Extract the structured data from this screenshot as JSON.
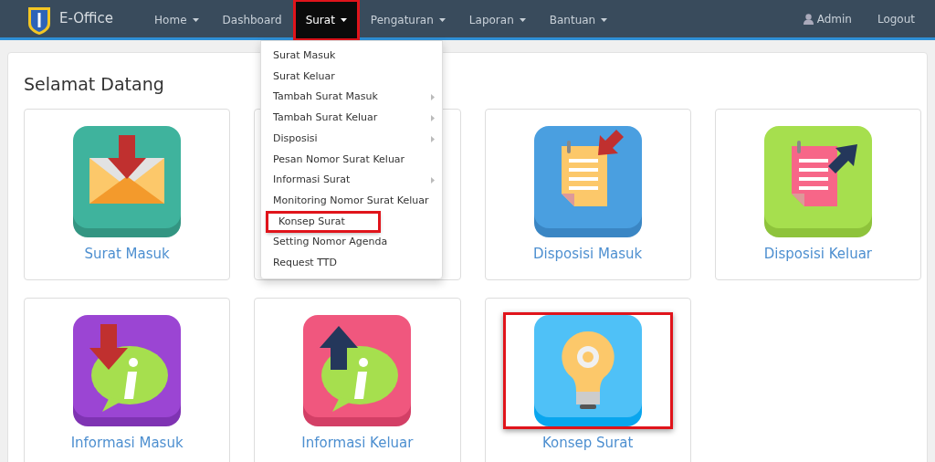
{
  "navbar": {
    "brand": "E-Office",
    "items": [
      {
        "label": "Home",
        "caret": true,
        "selected": false,
        "highlighted": false
      },
      {
        "label": "Dashboard",
        "caret": false,
        "selected": false,
        "highlighted": false
      },
      {
        "label": "Surat",
        "caret": true,
        "selected": true,
        "highlighted": true
      },
      {
        "label": "Pengaturan",
        "caret": true,
        "selected": false,
        "highlighted": false
      },
      {
        "label": "Laporan",
        "caret": true,
        "selected": false,
        "highlighted": false
      },
      {
        "label": "Bantuan",
        "caret": true,
        "selected": false,
        "highlighted": false
      }
    ],
    "user": "Admin",
    "logout": "Logout"
  },
  "dropdown": [
    {
      "label": "Surat Masuk",
      "submenu": false,
      "highlighted": false
    },
    {
      "label": "Surat Keluar",
      "submenu": false,
      "highlighted": false
    },
    {
      "label": "Tambah Surat Masuk",
      "submenu": true,
      "highlighted": false
    },
    {
      "label": "Tambah Surat Keluar",
      "submenu": true,
      "highlighted": false
    },
    {
      "label": "Disposisi",
      "submenu": true,
      "highlighted": false
    },
    {
      "label": "Pesan Nomor Surat Keluar",
      "submenu": false,
      "highlighted": false
    },
    {
      "label": "Informasi Surat",
      "submenu": true,
      "highlighted": false
    },
    {
      "label": "Monitoring Nomor Surat Keluar",
      "submenu": false,
      "highlighted": false
    },
    {
      "label": "Konsep Surat",
      "submenu": false,
      "highlighted": true
    },
    {
      "label": "Setting Nomor Agenda",
      "submenu": false,
      "highlighted": false
    },
    {
      "label": "Request TTD",
      "submenu": false,
      "highlighted": false
    }
  ],
  "heading": "Selamat Datang",
  "tiles": [
    {
      "kind": "mail-in",
      "label": "Surat Masuk",
      "highlighted": false
    },
    {
      "kind": "blank",
      "highlighted": false
    },
    {
      "kind": "doc-in",
      "label": "Disposisi Masuk",
      "highlighted": false
    },
    {
      "kind": "doc-out",
      "label": "Disposisi Keluar",
      "highlighted": false
    },
    {
      "kind": "info-in",
      "label": "Informasi Masuk",
      "highlighted": false
    },
    {
      "kind": "info-out",
      "label": "Informasi Keluar",
      "highlighted": false
    },
    {
      "kind": "bulb",
      "label": "Konsep Surat",
      "highlighted": true
    }
  ]
}
